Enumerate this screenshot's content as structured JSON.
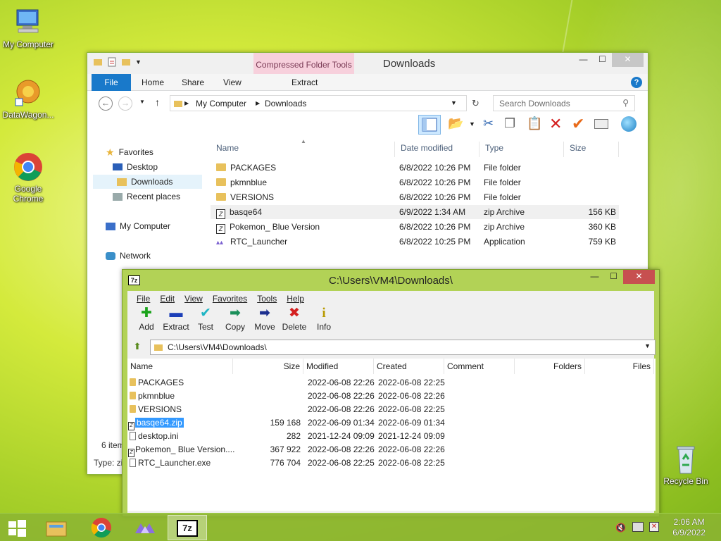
{
  "desktop": {
    "icons": [
      {
        "label": "My Computer",
        "icon": "computer-icon"
      },
      {
        "label": "DataWagon...",
        "icon": "datawagon-icon"
      },
      {
        "label": "Google Chrome",
        "icon": "chrome-icon"
      },
      {
        "label": "Recycle Bin",
        "icon": "recycle-bin-icon"
      }
    ]
  },
  "explorer": {
    "title": "Downloads",
    "context_tab": "Compressed Folder Tools",
    "tabs": [
      "File",
      "Home",
      "Share",
      "View",
      "Extract"
    ],
    "help": "?",
    "address": [
      "My Computer",
      "Downloads"
    ],
    "search_placeholder": "Search Downloads",
    "nav": {
      "favorites": "Favorites",
      "desktop": "Desktop",
      "downloads": "Downloads",
      "recent": "Recent places",
      "computer": "My Computer",
      "network": "Network"
    },
    "columns": [
      "Name",
      "Date modified",
      "Type",
      "Size"
    ],
    "files": [
      {
        "name": "PACKAGES",
        "date": "6/8/2022 10:26 PM",
        "type": "File folder",
        "size": ""
      },
      {
        "name": "pkmnblue",
        "date": "6/8/2022 10:26 PM",
        "type": "File folder",
        "size": ""
      },
      {
        "name": "VERSIONS",
        "date": "6/8/2022 10:26 PM",
        "type": "File folder",
        "size": ""
      },
      {
        "name": "basqe64",
        "date": "6/9/2022 1:34 AM",
        "type": "zip Archive",
        "size": "156 KB"
      },
      {
        "name": "Pokemon_ Blue Version",
        "date": "6/8/2022 10:26 PM",
        "type": "zip Archive",
        "size": "360 KB"
      },
      {
        "name": "RTC_Launcher",
        "date": "6/8/2022 10:25 PM",
        "type": "Application",
        "size": "759 KB"
      }
    ],
    "status_items": "6 item",
    "status_type": "Type: zi"
  },
  "sevenzip": {
    "title": "C:\\Users\\VM4\\Downloads\\",
    "logo": "7z",
    "menu": [
      "File",
      "Edit",
      "View",
      "Favorites",
      "Tools",
      "Help"
    ],
    "tools": [
      {
        "label": "Add",
        "glyph": "✚",
        "color": "#1aa31a"
      },
      {
        "label": "Extract",
        "glyph": "▬",
        "color": "#1c3fb8"
      },
      {
        "label": "Test",
        "glyph": "✔",
        "color": "#1fb5c4"
      },
      {
        "label": "Copy",
        "glyph": "➡",
        "color": "#1a8f5a"
      },
      {
        "label": "Move",
        "glyph": "➡",
        "color": "#1c2f8f"
      },
      {
        "label": "Delete",
        "glyph": "✖",
        "color": "#d42020"
      },
      {
        "label": "Info",
        "glyph": "i",
        "color": "#b89a00"
      }
    ],
    "path": "C:\\Users\\VM4\\Downloads\\",
    "columns": [
      "Name",
      "Size",
      "Modified",
      "Created",
      "Comment",
      "Folders",
      "Files"
    ],
    "files": [
      {
        "name": "PACKAGES",
        "size": "",
        "modified": "2022-06-08 22:26",
        "created": "2022-06-08 22:25",
        "icon": "folder"
      },
      {
        "name": "pkmnblue",
        "size": "",
        "modified": "2022-06-08 22:26",
        "created": "2022-06-08 22:26",
        "icon": "folder"
      },
      {
        "name": "VERSIONS",
        "size": "",
        "modified": "2022-06-08 22:26",
        "created": "2022-06-08 22:25",
        "icon": "folder"
      },
      {
        "name": "basqe64.zip",
        "size": "159 168",
        "modified": "2022-06-09 01:34",
        "created": "2022-06-09 01:34",
        "icon": "zip"
      },
      {
        "name": "desktop.ini",
        "size": "282",
        "modified": "2021-12-24 09:09",
        "created": "2021-12-24 09:09",
        "icon": "file"
      },
      {
        "name": "Pokemon_ Blue Version....",
        "size": "367 922",
        "modified": "2022-06-08 22:26",
        "created": "2022-06-08 22:26",
        "icon": "zip"
      },
      {
        "name": "RTC_Launcher.exe",
        "size": "776 704",
        "modified": "2022-06-08 22:25",
        "created": "2022-06-08 22:25",
        "icon": "file"
      }
    ]
  },
  "taskbar": {
    "time": "2:06 AM",
    "date": "6/9/2022",
    "apps": [
      "start-icon",
      "explorer-icon",
      "chrome-icon",
      "rtc-launcher-icon",
      "7zip-icon"
    ],
    "sevenzip_label": "7z"
  }
}
